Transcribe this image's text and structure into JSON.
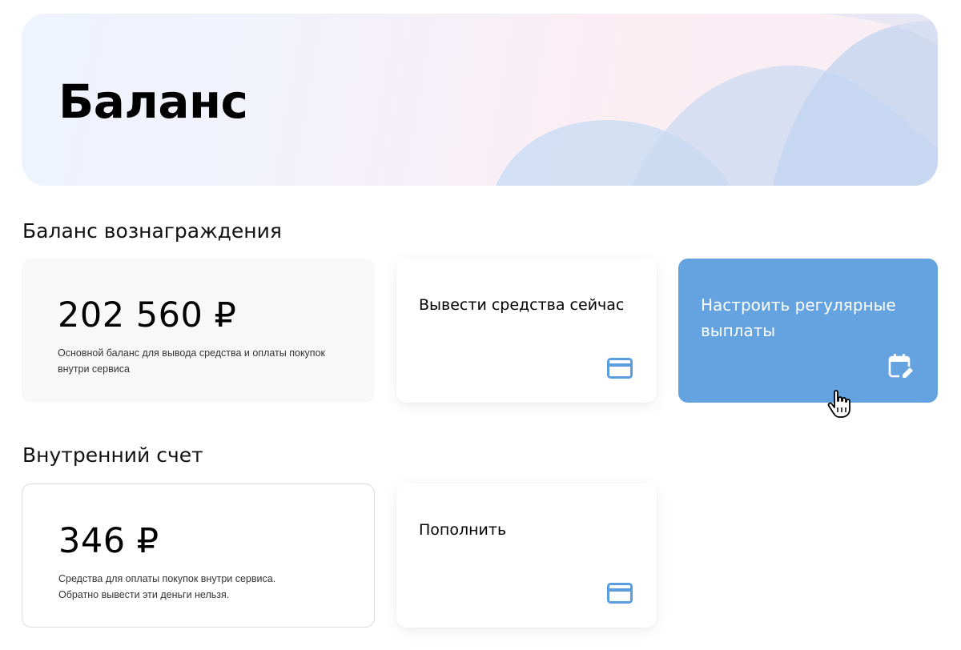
{
  "header": {
    "title": "Баланс"
  },
  "reward_section": {
    "title": "Баланс вознаграждения",
    "balance": {
      "amount": "202 560 ₽",
      "description": "Основной баланс для вывода средства и оплаты покупок внутри сервиса"
    },
    "actions": {
      "withdraw_label": "Вывести средства сейчас",
      "regular_label": "Настроить регулярные выплаты"
    }
  },
  "internal_section": {
    "title": "Внутренний счет",
    "balance": {
      "amount": "346 ₽",
      "description_line1": "Средства для оплаты покупок внутри сервиса.",
      "description_line2": "Обратно вывести эти деньги нельзя."
    },
    "actions": {
      "topup_label": "Пополнить"
    }
  },
  "icons": {
    "withdraw": "credit-card-icon",
    "regular": "calendar-edit-icon",
    "topup": "credit-card-icon"
  },
  "colors": {
    "accent": "#64a3e0",
    "icon_blue": "#5b9ee0",
    "reward_card_bg": "#f8f8f8"
  }
}
